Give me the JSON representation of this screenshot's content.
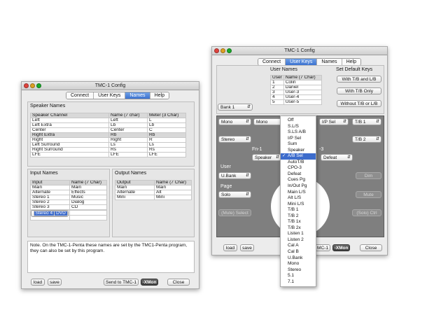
{
  "left": {
    "title": "TMC-1 Config",
    "tabs": [
      "Connect",
      "User Keys",
      "Names",
      "Help"
    ],
    "active_tab": "Names",
    "speaker_names_heading": "Speaker Names",
    "speaker_headers": [
      "Speaker Channel",
      "Name (7 char)",
      "Meter (3 Char)"
    ],
    "speaker_rows": [
      [
        "Left",
        "Left",
        "L"
      ],
      [
        "Left Extra",
        "Lb",
        "Lb"
      ],
      [
        "Center",
        "Center",
        "C"
      ],
      [
        "Right Extra",
        "Rb",
        "Rb"
      ],
      [
        "Right",
        "Right",
        "R"
      ],
      [
        "Left Surround",
        "Ls",
        "Ls"
      ],
      [
        "Right Surround",
        "Rs",
        "Rs"
      ],
      [
        "LFE",
        "LFE",
        "LFE"
      ]
    ],
    "input_names_heading": "Input Names",
    "input_headers": [
      "Input",
      "Name (7 Char)"
    ],
    "input_rows": [
      [
        "Main",
        "Main"
      ],
      [
        "Alternate",
        "Effects"
      ],
      [
        "Stereo 1",
        "Music"
      ],
      [
        "Stereo 2",
        "Dialog"
      ],
      [
        "Stereo 3",
        "CD"
      ],
      [
        "Stereo 4",
        "DVD"
      ]
    ],
    "output_names_heading": "Output Names",
    "output_headers": [
      "Output",
      "Name (7 Char)"
    ],
    "output_rows": [
      [
        "Main",
        "Main"
      ],
      [
        "Alternate",
        "Alt"
      ],
      [
        "Mini",
        "Mini"
      ]
    ],
    "note": "Note. On the TMC-1-Penta these names are set by the TMC1-Penta program, they can also be set by this program.",
    "load": "load",
    "save": "save",
    "send": "Send to TMC-1",
    "xmon": "-XMon",
    "close": "Close"
  },
  "right": {
    "title": "TMC-1 Config",
    "tabs": [
      "Connect",
      "User Keys",
      "Names",
      "Help"
    ],
    "active_tab": "User Keys",
    "user_names_heading": "User Names",
    "user_headers": [
      "User",
      "Name (7 Char)"
    ],
    "user_rows": [
      [
        "1",
        "Colin"
      ],
      [
        "2",
        "Daniel"
      ],
      [
        "3",
        "User-3"
      ],
      [
        "4",
        "User-4"
      ],
      [
        "5",
        "User-5"
      ]
    ],
    "default_keys_heading": "Set Default Keys",
    "default_buttons": [
      "With T/B and L/B",
      "With T/B Only",
      "Without T/B or L/B"
    ],
    "bank_select": "Bank 1",
    "mono1": "Mono",
    "mono2": "Mono",
    "ip_sel": "I/P Sel",
    "tb1": "T/B 1",
    "stereo": "Stereo",
    "tb2": "T/B 2",
    "fn1": "Fn-1",
    "fn3": "-3",
    "speaker": "Speaker",
    "defeat": "Defeat",
    "user_label": "User",
    "ubank": "U.Bank",
    "dim": "Dim",
    "page_label": "Page",
    "solo": "Solo",
    "mute": "Mute",
    "mute_select": "(Mute) Select",
    "solo_ctrl": "(Solo) Ctrl",
    "load": "load",
    "save": "save",
    "tmc1": "MC-1",
    "xmon": "-XMon",
    "close": "Close",
    "dropdown_items": [
      "Off",
      "S.L/S",
      "S.LS A/B",
      "I/P Sel",
      "Sum",
      "Speaker",
      "A/B Sel",
      "AutoT/B",
      "CPO-3",
      "Defeat",
      "Cues Pg",
      "In/Out Pg",
      "Main L/S",
      "Alt L/S",
      "Mini L/S",
      "T/B 1",
      "T/B 2",
      "T/B 1x",
      "T/B 2x",
      "Listen 1",
      "Listen 2",
      "Cal A",
      "Cal B",
      "U.Bank",
      "Mono",
      "Stereo",
      "5.1",
      "7.1"
    ],
    "dropdown_selected": "A/B Sel"
  }
}
